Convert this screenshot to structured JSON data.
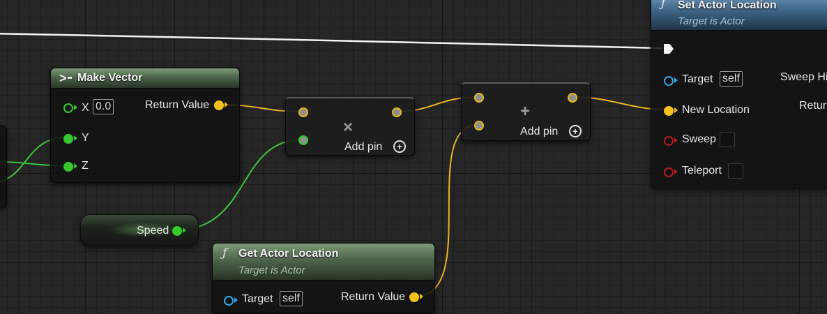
{
  "nodes": {
    "make_vector": {
      "title": "Make Vector",
      "pins": {
        "x": "X",
        "y": "Y",
        "z": "Z"
      },
      "x_value": "0.0",
      "output": "Return Value"
    },
    "multiply": {
      "symbol": "×",
      "add_pin": "Add pin"
    },
    "add": {
      "symbol": "+",
      "add_pin": "Add pin"
    },
    "speed": {
      "label": "Speed"
    },
    "get_actor_location": {
      "title": "Get Actor Location",
      "subtitle": "Target is Actor",
      "target_label": "Target",
      "target_value": "self",
      "output": "Return Value"
    },
    "set_actor_location": {
      "title": "Set Actor Location",
      "subtitle": "Target is Actor",
      "target_label": "Target",
      "target_value": "self",
      "new_location": "New Location",
      "sweep": "Sweep",
      "teleport": "Teleport",
      "sweep_hit": "Sweep Hit",
      "return": "Return"
    }
  },
  "colors": {
    "vector_wire": "#e9b224",
    "float_wire": "#3cc43a",
    "exec_wire": "#f4f4f4",
    "object_pin": "#36a5e6",
    "bool_pin": "#b31d1d"
  }
}
